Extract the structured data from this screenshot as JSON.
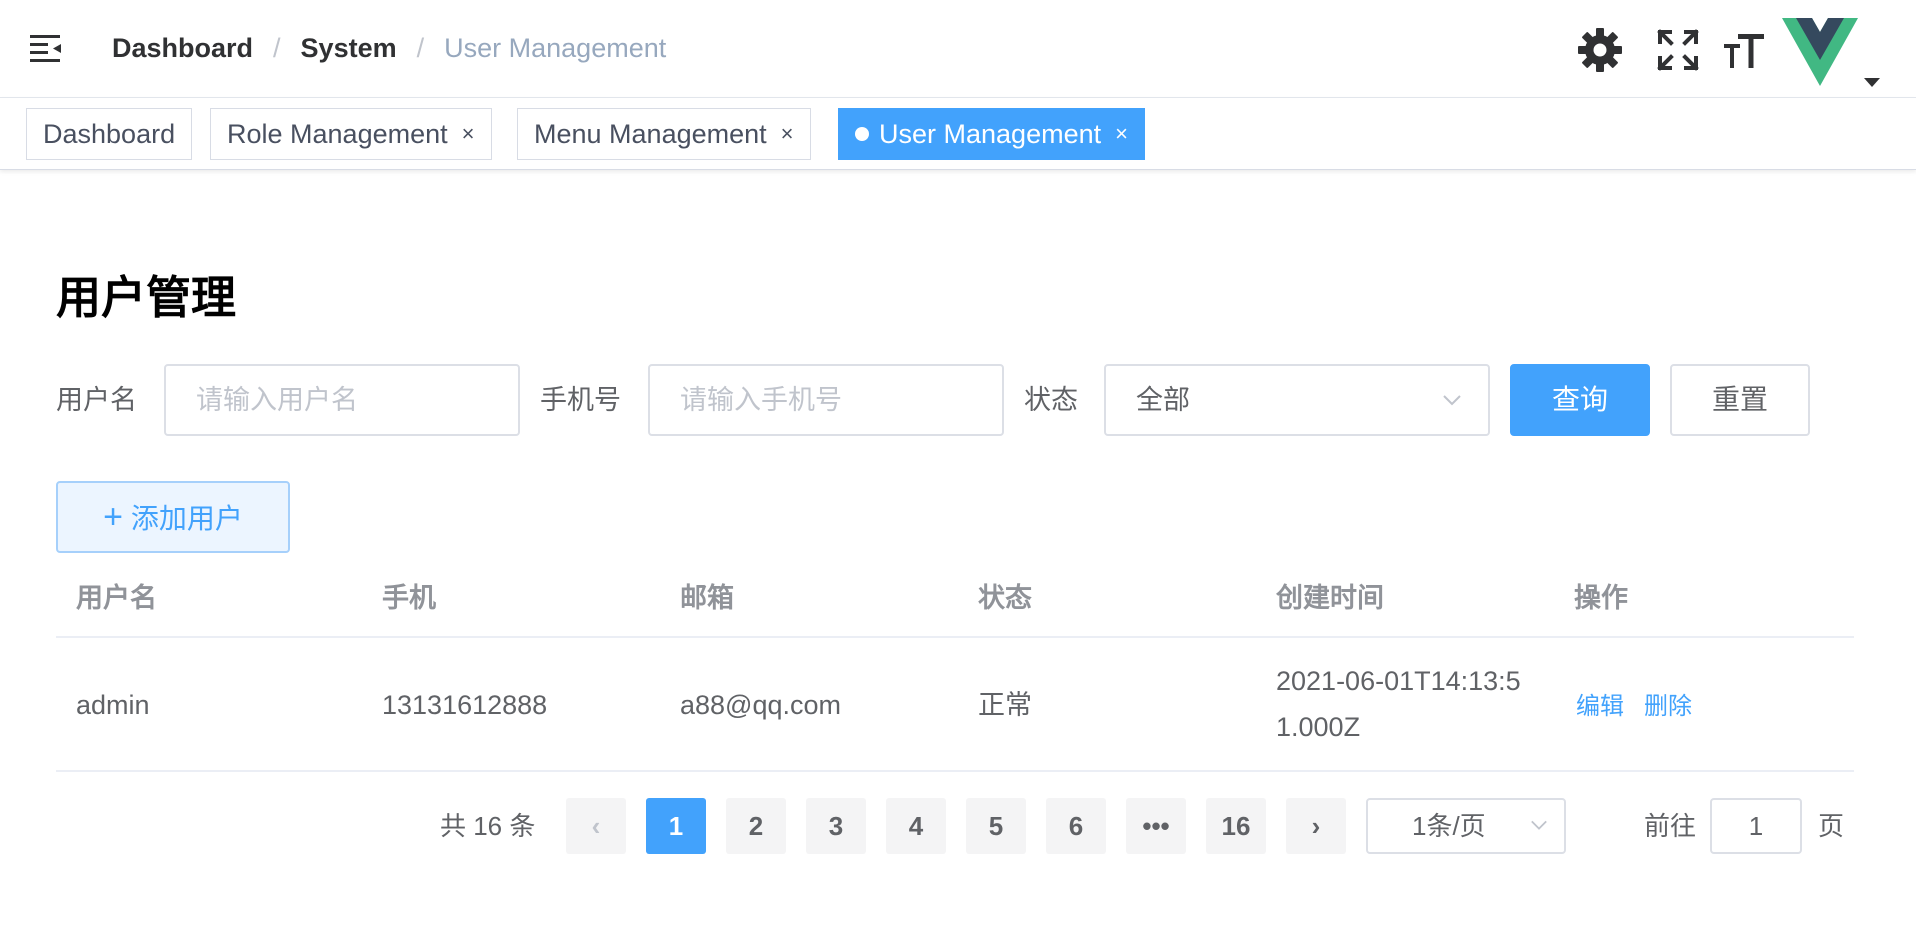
{
  "navbar": {
    "hamburger_icon": "hamburger-icon",
    "breadcrumb": [
      "Dashboard",
      "System",
      "User Management"
    ],
    "separator": "/",
    "icons": [
      "gear-icon",
      "fullscreen-icon",
      "font-size-icon"
    ],
    "avatar": "vue-logo-avatar"
  },
  "tags": [
    {
      "label": "Dashboard",
      "closable": false,
      "active": false
    },
    {
      "label": "Role Management",
      "closable": true,
      "active": false
    },
    {
      "label": "Menu Management",
      "closable": true,
      "active": false
    },
    {
      "label": "User Management",
      "closable": true,
      "active": true
    }
  ],
  "tag_close": "×",
  "page": {
    "title": "用户管理"
  },
  "search": {
    "username_label": "用户名",
    "username_placeholder": "请输入用户名",
    "phone_label": "手机号",
    "phone_placeholder": "请输入手机号",
    "status_label": "状态",
    "status_value": "全部",
    "query_button": "查询",
    "reset_button": "重置"
  },
  "add_button": {
    "icon": "+",
    "label": "添加用户"
  },
  "table": {
    "columns": [
      "用户名",
      "手机",
      "邮箱",
      "状态",
      "创建时间",
      "操作"
    ],
    "rows": [
      {
        "username": "admin",
        "phone": "13131612888",
        "email": "a88@qq.com",
        "status": "正常",
        "created_line1": "2021-06-01T14:13:5",
        "created_line2": "1.000Z",
        "actions": [
          "编辑",
          "删除"
        ]
      }
    ]
  },
  "pagination": {
    "total_text": "共 16 条",
    "prev": "‹",
    "pages": [
      "1",
      "2",
      "3",
      "4",
      "5",
      "6",
      "•••",
      "16"
    ],
    "current": "1",
    "next": "›",
    "page_size": "1条/页",
    "goto_label": "前往",
    "goto_value": "1",
    "goto_suffix": "页"
  },
  "colors": {
    "primary": "#42a2fc",
    "text": "#303133",
    "muted": "#909399",
    "border": "#dcdfe6"
  }
}
